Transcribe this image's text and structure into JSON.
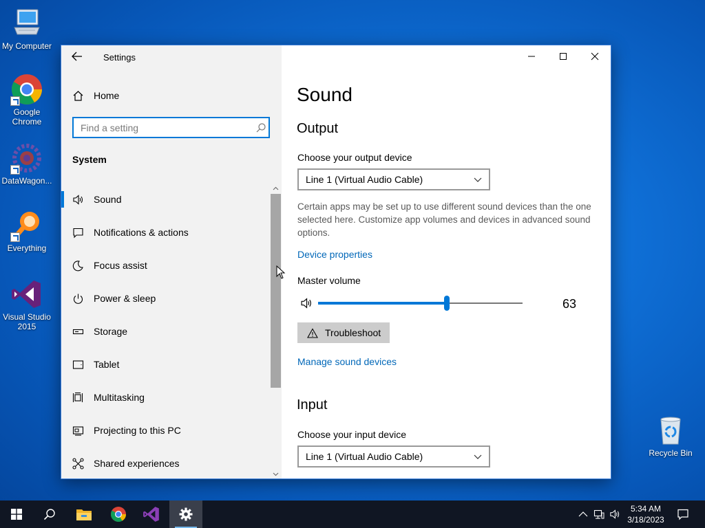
{
  "desktop": {
    "icons": [
      {
        "label": "My Computer"
      },
      {
        "label": "Google Chrome"
      },
      {
        "label": "DataWagon..."
      },
      {
        "label": "Everything"
      },
      {
        "label": "Visual Studio 2015"
      },
      {
        "label": "Recycle Bin"
      }
    ]
  },
  "window": {
    "title": "Settings",
    "nav": {
      "home_label": "Home",
      "search_placeholder": "Find a setting",
      "section_title": "System",
      "items": [
        {
          "label": "Sound",
          "icon": "speaker-icon",
          "selected": true
        },
        {
          "label": "Notifications & actions",
          "icon": "notification-icon"
        },
        {
          "label": "Focus assist",
          "icon": "moon-icon"
        },
        {
          "label": "Power & sleep",
          "icon": "power-icon"
        },
        {
          "label": "Storage",
          "icon": "storage-icon"
        },
        {
          "label": "Tablet",
          "icon": "tablet-icon"
        },
        {
          "label": "Multitasking",
          "icon": "multitasking-icon"
        },
        {
          "label": "Projecting to this PC",
          "icon": "projecting-icon"
        },
        {
          "label": "Shared experiences",
          "icon": "shared-experiences-icon"
        }
      ]
    },
    "content": {
      "page_title": "Sound",
      "output": {
        "heading": "Output",
        "device_label": "Choose your output device",
        "device_value": "Line 1 (Virtual Audio Cable)",
        "help_text": "Certain apps may be set up to use different sound devices than the one selected here. Customize app volumes and devices in advanced sound options.",
        "device_properties_link": "Device properties",
        "master_volume_label": "Master volume",
        "master_volume_value": 63,
        "master_volume_display": "63",
        "troubleshoot_label": "Troubleshoot",
        "manage_link": "Manage sound devices"
      },
      "input": {
        "heading": "Input",
        "device_label": "Choose your input device",
        "device_value": "Line 1 (Virtual Audio Cable)"
      }
    }
  },
  "taskbar": {
    "pinned": [
      "start-icon",
      "search-icon",
      "file-explorer-icon",
      "chrome-icon",
      "visual-studio-icon",
      "settings-icon"
    ],
    "clock_time": "5:34 AM",
    "clock_date": "3/18/2023"
  },
  "colors": {
    "accent": "#0078d7",
    "link": "#0067b8",
    "taskbar": "#101623"
  }
}
